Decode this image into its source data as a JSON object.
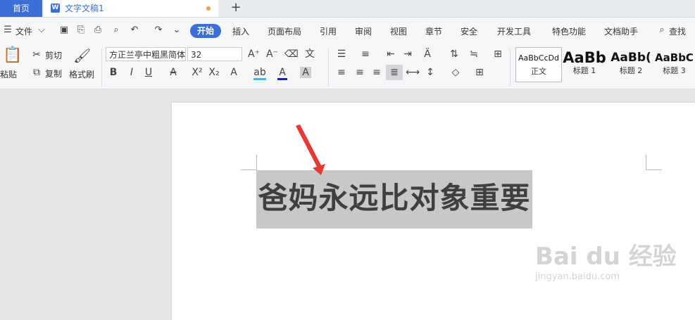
{
  "tabs": {
    "home": "首页",
    "document": "文字文稿1",
    "new_tab": "+"
  },
  "menu": {
    "file": "文件",
    "items": [
      "开始",
      "插入",
      "页面布局",
      "引用",
      "审阅",
      "视图",
      "章节",
      "安全",
      "开发工具",
      "特色功能",
      "文档助手"
    ],
    "search": "查找"
  },
  "ribbon": {
    "paste": "粘贴",
    "cut": "剪切",
    "copy": "复制",
    "format_painter": "格式刷",
    "font_name": "方正兰亭中粗黑简体",
    "font_size": "32",
    "bold": "B",
    "italic": "I",
    "underline": "U",
    "styles": [
      {
        "preview": "AaBbCcDd",
        "label": "正文"
      },
      {
        "preview": "AaBb",
        "label": "标题 1"
      },
      {
        "preview": "AaBb(",
        "label": "标题 2"
      },
      {
        "preview": "AaBbC",
        "label": "标题 3"
      }
    ]
  },
  "document": {
    "text": "爸妈永远比对象重要"
  },
  "watermark": {
    "brand": "Bai du 经验",
    "url": "jingyan.baidu.com"
  },
  "colors": {
    "accent": "#3b6fd6",
    "arrow": "#e53935",
    "highlight": "#c8c8c8"
  }
}
